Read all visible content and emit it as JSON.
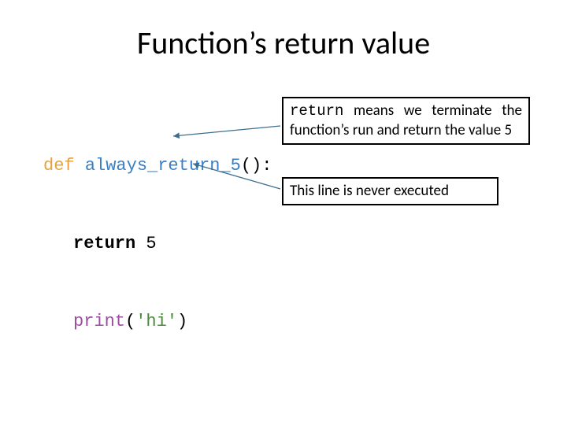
{
  "title": "Function’s return value",
  "code": {
    "l1": {
      "kw": "def",
      "space1": " ",
      "fn": "always_return_5",
      "paren": "():"
    },
    "l2": {
      "kw": "return",
      "space": " ",
      "val": "5"
    },
    "l3": {
      "fn": "print",
      "lparen": "(",
      "str": "'hi'",
      "rparen": ")"
    }
  },
  "callouts": {
    "c1": {
      "mono": "return",
      "rest": " means we terminate the function’s run and return the value 5"
    },
    "c2": {
      "text": "This line is never executed"
    }
  }
}
